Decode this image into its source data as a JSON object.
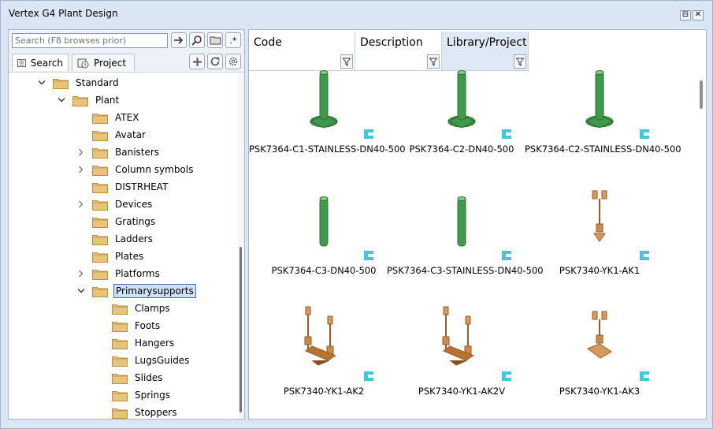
{
  "window": {
    "title": "Vertex G4 Plant Design",
    "restore_glyph": "⊟",
    "close_glyph": "✕"
  },
  "search": {
    "placeholder": "Search (F8 browses prior)",
    "regex_glyph": ".*"
  },
  "tabs": [
    {
      "label": "Search",
      "icon": "list-icon"
    },
    {
      "label": "Project",
      "icon": "project-icon"
    }
  ],
  "tree": [
    {
      "label": "Standard",
      "expanded": true
    },
    {
      "label": "Plant",
      "expanded": true
    },
    {
      "label": "ATEX"
    },
    {
      "label": "Avatar"
    },
    {
      "label": "Banisters",
      "collapsed": true
    },
    {
      "label": "Column symbols",
      "collapsed": true
    },
    {
      "label": "DISTRHEAT"
    },
    {
      "label": "Devices",
      "collapsed": true
    },
    {
      "label": "Gratings"
    },
    {
      "label": "Ladders"
    },
    {
      "label": "Plates"
    },
    {
      "label": "Platforms",
      "collapsed": true
    },
    {
      "label": "Primarysupports",
      "expanded": true,
      "selected": true
    },
    {
      "label": "Clamps"
    },
    {
      "label": "Foots"
    },
    {
      "label": "Hangers"
    },
    {
      "label": "LugsGuides"
    },
    {
      "label": "Slides"
    },
    {
      "label": "Springs"
    },
    {
      "label": "Stoppers"
    }
  ],
  "columns": [
    {
      "label": "Code"
    },
    {
      "label": "Description"
    },
    {
      "label": "Library/Project"
    }
  ],
  "items": [
    {
      "caption": "PSK7364-C1-STAINLESS-DN40-500",
      "kind": "green-stand"
    },
    {
      "caption": "PSK7364-C2-DN40-500",
      "kind": "green-stand"
    },
    {
      "caption": "PSK7364-C2-STAINLESS-DN40-500",
      "kind": "green-stand"
    },
    {
      "caption": "PSK7364-C3-DN40-500",
      "kind": "green-pipe"
    },
    {
      "caption": "PSK7364-C3-STAINLESS-DN40-500",
      "kind": "green-pipe"
    },
    {
      "caption": "PSK7340-YK1-AK1",
      "kind": "hanger"
    },
    {
      "caption": "PSK7340-YK1-AK2",
      "kind": "double-hanger"
    },
    {
      "caption": "PSK7340-YK1-AK2V",
      "kind": "double-hanger"
    },
    {
      "caption": "PSK7340-YK1-AK3",
      "kind": "angle-hanger"
    }
  ],
  "colors": {
    "folder": "#e8c47a",
    "folder_edge": "#b89040",
    "green": "#3f9a4a",
    "green_dark": "#2b6e34",
    "brown": "#9a5a2a",
    "badge": "#42c7dc"
  }
}
